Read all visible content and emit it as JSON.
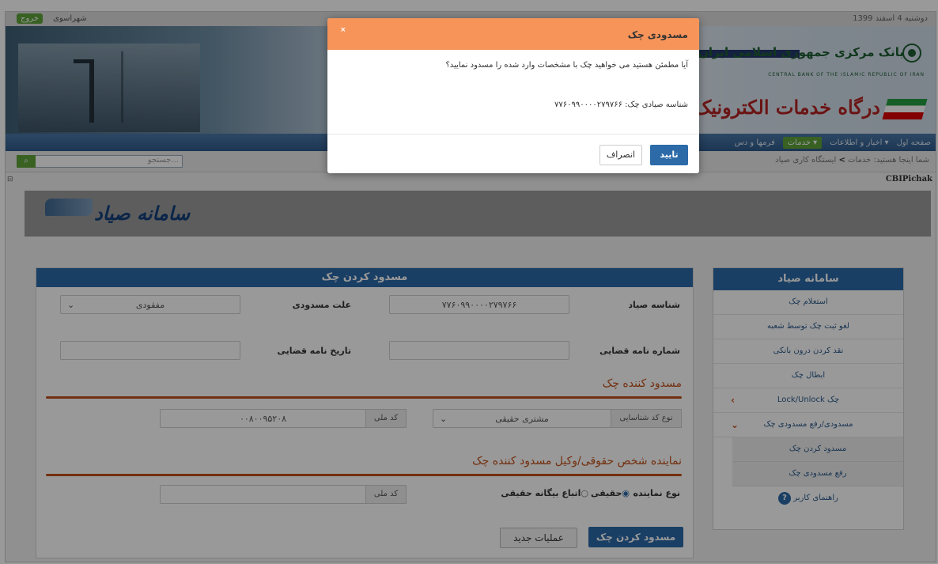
{
  "header": {
    "date": "دوشنبه 4 اسفند 1399",
    "city": "شهراسوی",
    "exit_label": "خروج",
    "bank_name": "بانک مرکزی جمهوری اسلامی ایران",
    "bank_name_en": "CENTRAL BANK OF THE ISLAMIC REPUBLIC OF IRAN",
    "portal_title": "درگاه خدمات الکترونیک"
  },
  "nav": {
    "home": "صفحه اول",
    "news": "اخبار و اطلاعات",
    "services": "خدمات",
    "forms": "فرمها و دس"
  },
  "breadcrumb": {
    "prefix": "شما اینجا هستید:",
    "services": "خدمات",
    "separator": ">",
    "current": "ایستگاه کاری صیاد"
  },
  "search": {
    "placeholder": "جستجو..."
  },
  "app_id": "CBIPichak",
  "sayad_logo": "سامانه صیاد",
  "form": {
    "title": "مسدود کردن چک",
    "sayad_id_label": "شناسه صیاد",
    "sayad_id_value": "۷۷۶۰۹۹۰۰۰۰۲۷۹۷۶۶",
    "block_reason_label": "علت مسدودی",
    "block_reason_value": "مفقودی",
    "judicial_letter_label": "شماره نامه قضایی",
    "judicial_date_label": "تاریخ نامه قضایی",
    "blocker_section": "مسدود کننده چک",
    "id_type_label": "نوع کد شناسایی",
    "id_type_value": "مشتری حقیقی",
    "national_code_label": "کد ملی",
    "national_code_value": "۰۰۸۰۰۹۵۲۰۸",
    "rep_section": "نماینده شخص حقوقی/وکیل مسدود کننده چک",
    "rep_type_label": "نوع نماینده",
    "rep_option_real": "حقیقی",
    "rep_option_foreign": "اتباع بیگانه حقیقی",
    "rep_national_code_label": "کد ملی",
    "submit_label": "مسدود کردن چک",
    "new_op_label": "عملیات جدید"
  },
  "sidebar": {
    "title": "سامانه صیاد",
    "items": [
      {
        "label": "استعلام چک"
      },
      {
        "label": "لغو ثبت چک توسط شعبه"
      },
      {
        "label": "نقد کردن درون بانکی"
      },
      {
        "label": "ابطال چک"
      },
      {
        "label": "Lock/Unlock چک"
      },
      {
        "label": "مسدودی/رفع مسدودی چک"
      }
    ],
    "sub_items": [
      {
        "label": "مسدود کردن چک"
      },
      {
        "label": "رفع مسدودی چک"
      }
    ],
    "help": "راهنمای کاربر"
  },
  "modal": {
    "title": "مسدودی چک",
    "close": "×",
    "message": "آیا مطمئن هستید می خواهید چک با مشخصات وارد شده را مسدود نمایید؟",
    "id_line": "شناسه صیادی چک: ۷۷۶۰۹۹۰۰۰۰۲۷۹۷۶۶",
    "confirm": "تایید",
    "cancel": "انصراف"
  },
  "colors": {
    "primary": "#2c6aa8",
    "accent": "#c0501a",
    "modal_header": "#f6945a",
    "green": "#5ea23a"
  }
}
